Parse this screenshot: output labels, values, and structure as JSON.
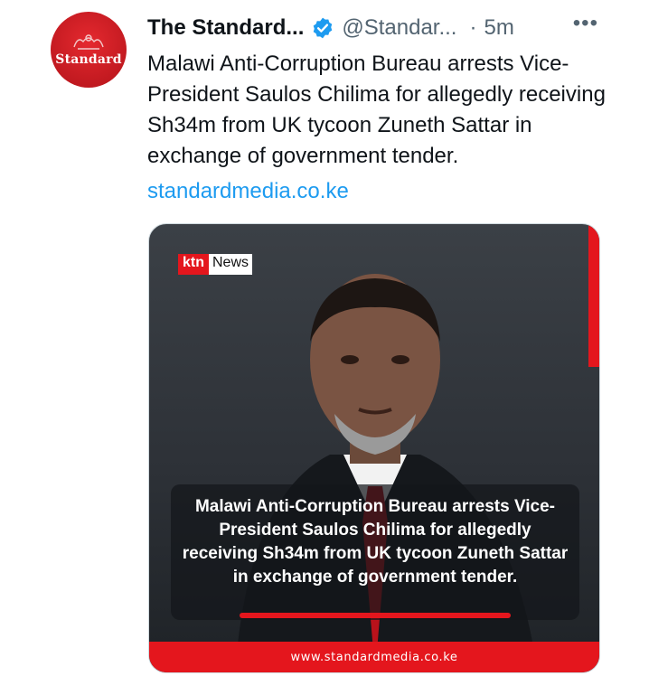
{
  "tweet": {
    "account_name": "The Standard...",
    "handle": "@Standar...",
    "separator": "·",
    "time": "5m",
    "more_label": "•••",
    "avatar_label": "Standard",
    "text": "Malawi Anti-Corruption Bureau arrests Vice-President Saulos Chilima for allegedly receiving Sh34m from UK tycoon Zuneth Sattar in exchange of government tender.",
    "link": "standardmedia.co.ke"
  },
  "media": {
    "logo_ktn": "ktn",
    "logo_news": "News",
    "caption": "Malawi Anti-Corruption Bureau arrests Vice-President Saulos Chilima for allegedly receiving Sh34m from UK tycoon Zuneth Sattar in exchange of government tender.",
    "footer_url": "www.standardmedia.co.ke"
  },
  "colors": {
    "brand_red": "#e4161d",
    "link_blue": "#1d9bf0",
    "muted_gray": "#536471"
  },
  "icons": {
    "verified": "verified-badge-icon",
    "more": "more-options-icon"
  }
}
